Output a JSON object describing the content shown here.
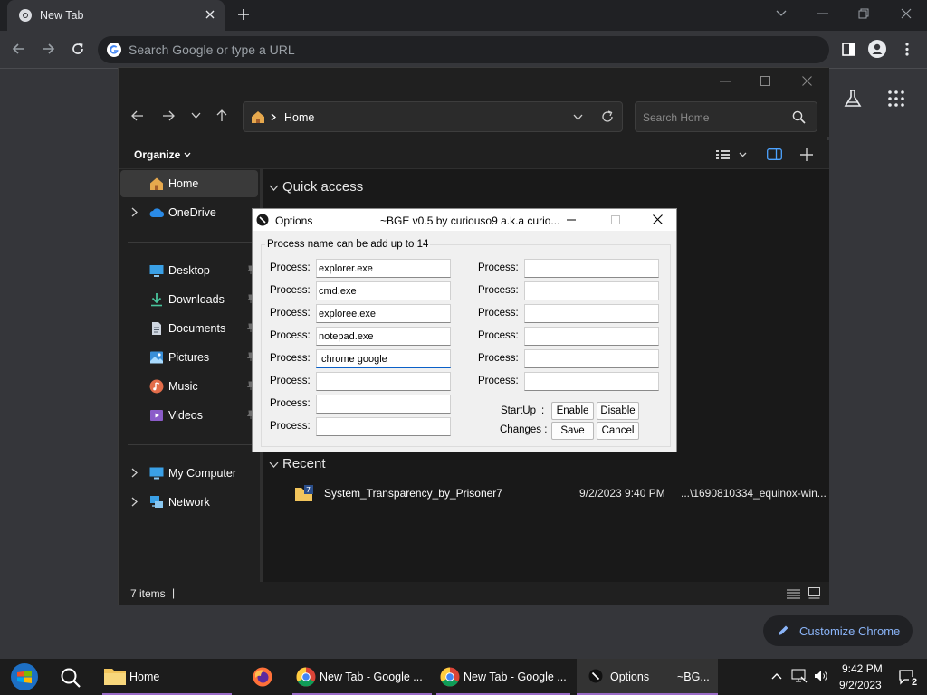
{
  "chrome": {
    "tab_title": "New Tab",
    "omnibox_placeholder": "Search Google or type a URL",
    "customize_label": "Customize Chrome"
  },
  "explorer": {
    "address_location": "Home",
    "search_placeholder": "Search Home",
    "organize_label": "Organize",
    "nav": {
      "home": "Home",
      "onedrive": "OneDrive",
      "desktop": "Desktop",
      "downloads": "Downloads",
      "documents": "Documents",
      "pictures": "Pictures",
      "music": "Music",
      "videos": "Videos",
      "my_computer": "My Computer",
      "network": "Network"
    },
    "quick_access_heading": "Quick access",
    "recent_heading": "Recent",
    "recent_item": {
      "name": "System_Transparency_by_Prisoner7",
      "date": "9/2/2023 9:40 PM",
      "location": "...\\1690810334_equinox-win..."
    },
    "status_items": "7 items",
    "status_sep": "|"
  },
  "dialog": {
    "title": "Options",
    "subtitle": "~BGE v0.5 by curiouso9 a.k.a curio...",
    "group_label": "Process name can be add up to 14",
    "process_label": "Process:",
    "left_values": [
      "explorer.exe",
      "cmd.exe",
      "exploree.exe",
      "notepad.exe",
      "chrome google",
      "",
      "",
      ""
    ],
    "right_values": [
      "",
      "",
      "",
      "",
      "",
      ""
    ],
    "startup_label": "StartUp",
    "changes_label": "Changes :",
    "colon": ":",
    "enable_label": "Enable",
    "disable_label": "Disable",
    "save_label": "Save",
    "cancel_label": "Cancel"
  },
  "taskbar": {
    "explorer_label": "Home",
    "chrome1_label": "New Tab - Google ...",
    "chrome2_label": "New Tab - Google ...",
    "options_label": "Options",
    "options_extra": "~BG...",
    "time": "9:42 PM",
    "date": "9/2/2023",
    "notif_count": "2"
  },
  "colors": {
    "accent_blue": "#0a60c8",
    "taskbar_indicator": "#9a6bc7",
    "folder_yellow": "#f2c55c"
  }
}
